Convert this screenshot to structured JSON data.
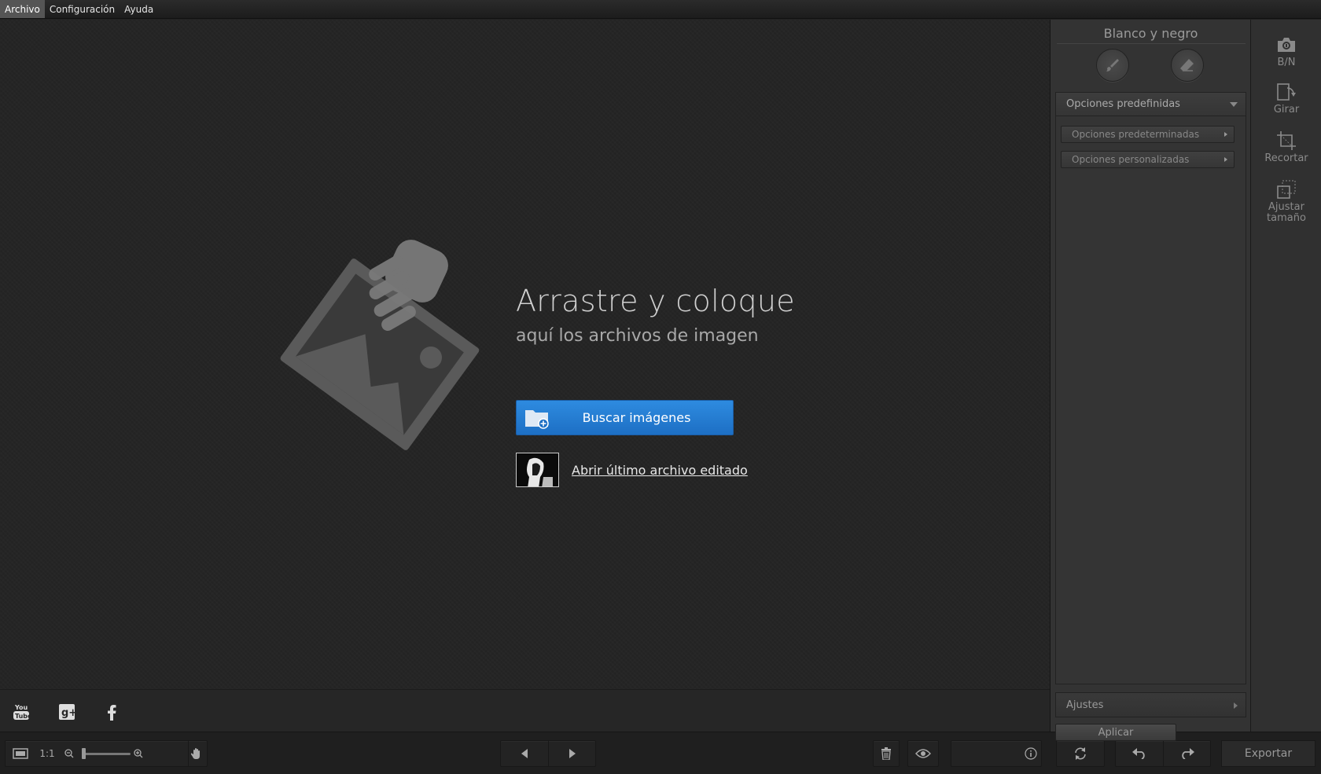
{
  "menu": {
    "items": [
      {
        "label": "Archivo",
        "active": true
      },
      {
        "label": "Configuración"
      },
      {
        "label": "Ayuda"
      }
    ]
  },
  "canvas": {
    "drop_title": "Arrastre y coloque",
    "drop_subtitle": "aquí los archivos de imagen",
    "browse_label": "Buscar imágenes",
    "last_file_label": "Abrir último archivo editado"
  },
  "social": {
    "icons": [
      "youtube-icon",
      "google-plus-icon",
      "facebook-icon"
    ]
  },
  "statusbar": {
    "zoom_ratio": "1:1",
    "export_label": "Exportar"
  },
  "panel": {
    "title": "Blanco y negro",
    "presets_label": "Opciones predefinidas",
    "default_options": "Opciones predeterminadas",
    "custom_options": "Opciones personalizadas",
    "ajustes_label": "Ajustes",
    "apply_label": "Aplicar"
  },
  "tools": {
    "bw": "B/N",
    "rotate": "Girar",
    "crop": "Recortar",
    "resize": "Ajustar tamaño"
  },
  "colors": {
    "accent": "#2e8be0",
    "background": "#252525"
  }
}
